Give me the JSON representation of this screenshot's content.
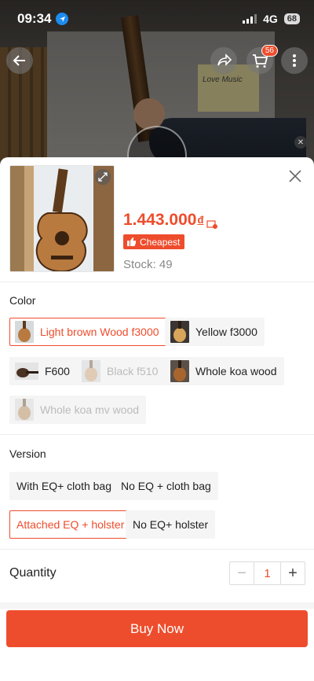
{
  "status_bar": {
    "time": "09:34",
    "network": "4G",
    "battery": "68"
  },
  "header": {
    "cart_count": "56",
    "poster_text": "Love Music"
  },
  "product": {
    "price": "1.443.000",
    "currency": "đ",
    "badge_label": "Cheapest",
    "stock_text": "Stock: 49"
  },
  "color_section": {
    "title": "Color",
    "options": [
      {
        "label": "Light brown Wood f3000",
        "state": "selected"
      },
      {
        "label": "Yellow f3000",
        "state": "normal"
      },
      {
        "label": "F600",
        "state": "normal"
      },
      {
        "label": "Black f510",
        "state": "disabled"
      },
      {
        "label": "Whole koa wood",
        "state": "normal"
      },
      {
        "label": "Whole koa mv wood",
        "state": "disabled"
      }
    ]
  },
  "version_section": {
    "title": "Version",
    "options": [
      {
        "label": "With EQ+ cloth bag",
        "state": "normal"
      },
      {
        "label": "No EQ + cloth bag",
        "state": "normal"
      },
      {
        "label": "Attached EQ + holster",
        "state": "selected"
      },
      {
        "label": "No EQ+ holster",
        "state": "normal"
      }
    ]
  },
  "quantity": {
    "label": "Quantity",
    "value": "1",
    "minus": "−",
    "plus": "+"
  },
  "buy_button": {
    "label": "Buy Now"
  },
  "colors": {
    "accent": "#ee4d2d",
    "disabled_text": "#bbbbbb",
    "option_bg": "#f5f5f5"
  }
}
